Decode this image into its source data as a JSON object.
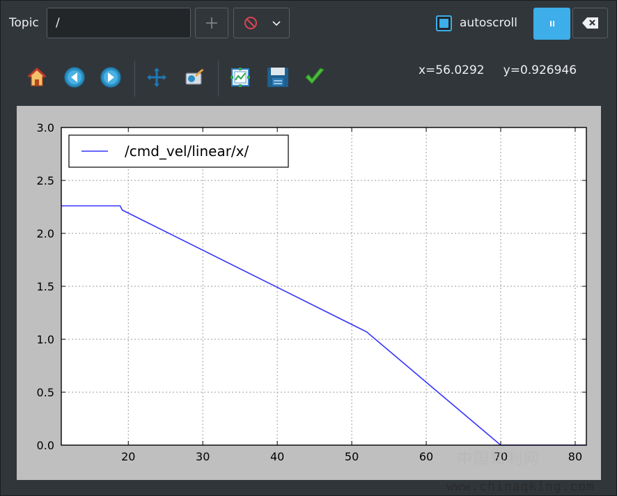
{
  "topbar": {
    "topic_label": "Topic",
    "topic_value": "/",
    "autoscroll_label": "autoscroll",
    "autoscroll_checked": true,
    "accent": "#3daee9"
  },
  "toolbar": {
    "tools": [
      "home-icon",
      "back-icon",
      "forward-icon",
      "pan-icon",
      "zoom-to-rect-icon",
      "subplots-config-icon",
      "save-icon",
      "edit-curves-icon"
    ],
    "coord_x": "x=56.0292",
    "coord_y": "y=0.926946"
  },
  "chart_data": {
    "type": "line",
    "title": "",
    "xlabel": "",
    "ylabel": "",
    "xlim": [
      11,
      81.5
    ],
    "ylim": [
      0,
      3
    ],
    "xticks": [
      20,
      30,
      40,
      50,
      60,
      70,
      80
    ],
    "xtick_labels": [
      "20",
      "30",
      "40",
      "50",
      "60",
      "70",
      "80"
    ],
    "yticks": [
      0,
      0.5,
      1,
      1.5,
      2,
      2.5,
      3
    ],
    "ytick_labels": [
      "0.0",
      "0.5",
      "1.0",
      "1.5",
      "2.0",
      "2.5",
      "3.0"
    ],
    "grid": true,
    "legend_position": "top-left",
    "series": [
      {
        "name": "/cmd_vel/linear/x/",
        "color": "#3333ff",
        "x": [
          11,
          18.9,
          19.2,
          52.0,
          70.0,
          81.5
        ],
        "y": [
          2.26,
          2.26,
          2.22,
          1.07,
          0.0,
          0.0
        ]
      }
    ]
  },
  "watermark": {
    "text_cn": "中国知利网",
    "url": "www.chinaqking.com"
  }
}
